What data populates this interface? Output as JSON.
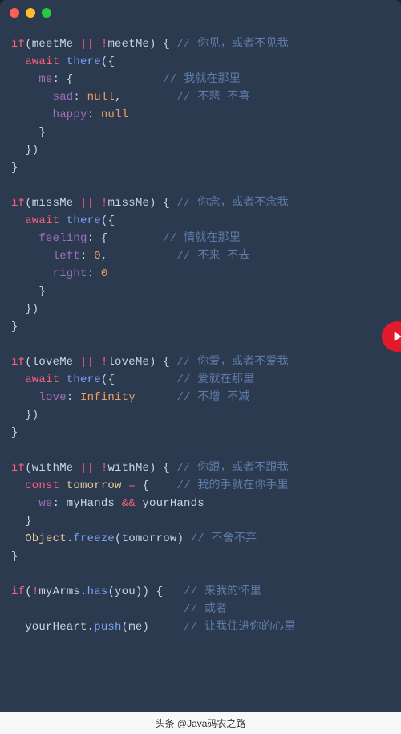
{
  "titlebar": {
    "colors": {
      "red": "#ff5f56",
      "yellow": "#ffbd2e",
      "green": "#27c93f"
    }
  },
  "code": {
    "b1": {
      "l1a": "if",
      "l1b": "(meetMe ",
      "l1c": "||",
      "l1d": " ",
      "l1e": "!",
      "l1f": "meetMe) { ",
      "l1g": "// ",
      "l1h": "你见，或者不见我",
      "l2a": "  ",
      "l2b": "await",
      "l2c": " ",
      "l2d": "there",
      "l2e": "({",
      "l3a": "    ",
      "l3b": "me",
      "l3c": ": {",
      "l3pad": "             ",
      "l3d": "// ",
      "l3e": "我就在那里",
      "l4a": "      ",
      "l4b": "sad",
      "l4c": ": ",
      "l4d": "null",
      "l4e": ",",
      "l4pad": "        ",
      "l4f": "// ",
      "l4g": "不悲 不喜",
      "l5a": "      ",
      "l5b": "happy",
      "l5c": ": ",
      "l5d": "null",
      "l6": "    }",
      "l7": "  })",
      "l8": "}"
    },
    "b2": {
      "l1a": "if",
      "l1b": "(missMe ",
      "l1c": "||",
      "l1d": " ",
      "l1e": "!",
      "l1f": "missMe) { ",
      "l1g": "// ",
      "l1h": "你念，或者不念我",
      "l2a": "  ",
      "l2b": "await",
      "l2c": " ",
      "l2d": "there",
      "l2e": "({",
      "l3a": "    ",
      "l3b": "feeling",
      "l3c": ": {",
      "l3pad": "        ",
      "l3d": "// ",
      "l3e": "情就在那里",
      "l4a": "      ",
      "l4b": "left",
      "l4c": ": ",
      "l4d": "0",
      "l4e": ",",
      "l4pad": "          ",
      "l4f": "// ",
      "l4g": "不来 不去",
      "l5a": "      ",
      "l5b": "right",
      "l5c": ": ",
      "l5d": "0",
      "l6": "    }",
      "l7": "  })",
      "l8": "}"
    },
    "b3": {
      "l1a": "if",
      "l1b": "(loveMe ",
      "l1c": "||",
      "l1d": " ",
      "l1e": "!",
      "l1f": "loveMe) { ",
      "l1g": "// ",
      "l1h": "你爱，或者不爱我",
      "l2a": "  ",
      "l2b": "await",
      "l2c": " ",
      "l2d": "there",
      "l2e": "({",
      "l2pad": "         ",
      "l2f": "// ",
      "l2g": "爱就在那里",
      "l3a": "    ",
      "l3b": "love",
      "l3c": ": ",
      "l3d": "Infinity",
      "l3pad": "      ",
      "l3e": "// ",
      "l3f": "不增 不减",
      "l4": "  })",
      "l5": "}"
    },
    "b4": {
      "l1a": "if",
      "l1b": "(withMe ",
      "l1c": "||",
      "l1d": " ",
      "l1e": "!",
      "l1f": "withMe) { ",
      "l1g": "// ",
      "l1h": "你跟，或者不跟我",
      "l2a": "  ",
      "l2b": "const",
      "l2c": " ",
      "l2d": "tomorrow",
      "l2e": " ",
      "l2f": "=",
      "l2g": " {",
      "l2pad": "    ",
      "l2h": "// ",
      "l2i": "我的手就在你手里",
      "l3a": "    ",
      "l3b": "we",
      "l3c": ": myHands ",
      "l3d": "&&",
      "l3e": " yourHands",
      "l4": "  }",
      "l5a": "  ",
      "l5b": "Object",
      "l5c": ".",
      "l5d": "freeze",
      "l5e": "(tomorrow) ",
      "l5f": "// ",
      "l5g": "不舍不弃",
      "l6": "}"
    },
    "b5": {
      "l1a": "if",
      "l1b": "(",
      "l1c": "!",
      "l1d": "myArms.",
      "l1e": "has",
      "l1f": "(you)) {",
      "l1pad": "   ",
      "l1g": "// ",
      "l1h": "来我的怀里",
      "l2pad": "                         ",
      "l2a": "// ",
      "l2b": "或者",
      "l3a": "  yourHeart.",
      "l3b": "push",
      "l3c": "(me)",
      "l3pad": "     ",
      "l3d": "// ",
      "l3e": "让我住进你的心里"
    }
  },
  "footer": {
    "text": "头条 @Java码农之路"
  }
}
